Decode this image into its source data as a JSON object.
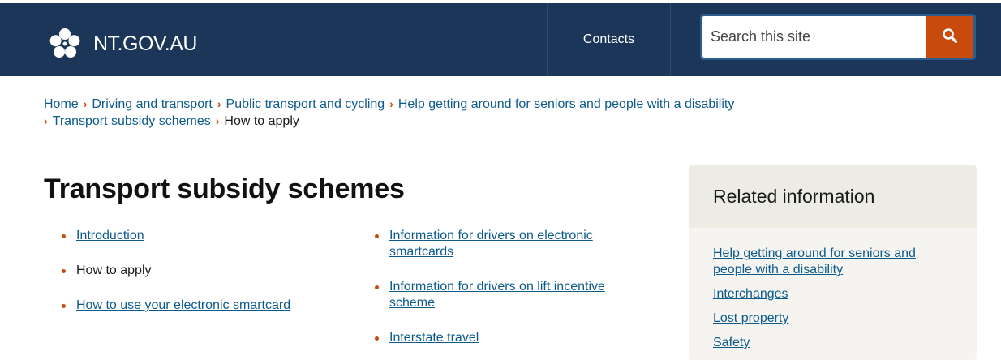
{
  "header": {
    "site_name": "NT.GOV.AU",
    "logo_icon": "floral-emblem-icon",
    "nav": {
      "contacts": "Contacts"
    },
    "search": {
      "placeholder": "Search this site",
      "icon": "search-icon"
    }
  },
  "breadcrumb": {
    "items": [
      "Home",
      "Driving and transport",
      "Public transport and cycling",
      "Help getting around for seniors and people with a disability",
      "Transport subsidy schemes"
    ],
    "current": "How to apply"
  },
  "main": {
    "title": "Transport subsidy schemes",
    "links_left": [
      {
        "label": "Introduction"
      },
      {
        "label": "How to apply"
      },
      {
        "label": "How to use your electronic smartcard"
      }
    ],
    "links_right": [
      {
        "label": "Information for drivers on electronic smartcards"
      },
      {
        "label": "Information for drivers on lift incentive scheme"
      },
      {
        "label": "Interstate travel"
      }
    ]
  },
  "sidebar": {
    "title": "Related information",
    "links": [
      "Help getting around for seniors and people with a disability",
      "Interchanges",
      "Lost property",
      "Safety"
    ]
  },
  "colors": {
    "header_bg": "#1b3658",
    "accent_orange": "#c84b0c",
    "link_blue": "#0d5b8c",
    "sidebar_bg": "#f5f4f0"
  }
}
